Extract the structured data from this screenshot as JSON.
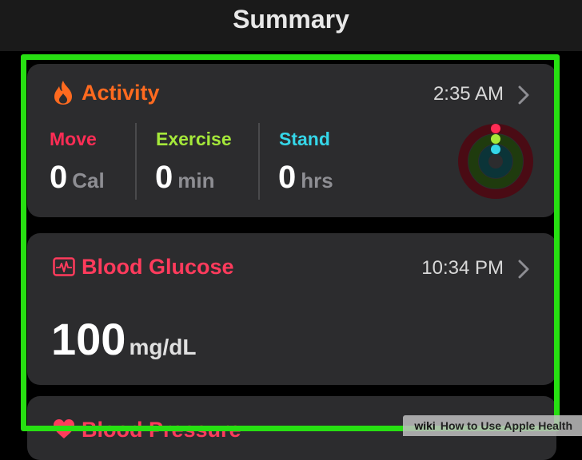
{
  "header": {
    "title": "Summary"
  },
  "activity": {
    "title": "Activity",
    "time": "2:35 AM",
    "metrics": [
      {
        "label": "Move",
        "value": "0",
        "unit": "Cal"
      },
      {
        "label": "Exercise",
        "value": "0",
        "unit": "min"
      },
      {
        "label": "Stand",
        "value": "0",
        "unit": "hrs"
      }
    ],
    "icon": "flame-icon",
    "colors": {
      "title": "#ff6a1f",
      "move": "#ff2d55",
      "exercise": "#a5e83a",
      "stand": "#35d6e8"
    }
  },
  "blood_glucose": {
    "title": "Blood Glucose",
    "time": "10:34 PM",
    "value": "100",
    "unit": "mg/dL",
    "icon": "waveform-icon",
    "color": "#ff3b5c"
  },
  "blood_pressure": {
    "title": "Blood Pressure",
    "icon": "heart-icon",
    "color": "#ff3b5c"
  },
  "highlight_color": "#27e012",
  "watermark": {
    "brand": "wiki",
    "text": "How to Use Apple Health"
  }
}
